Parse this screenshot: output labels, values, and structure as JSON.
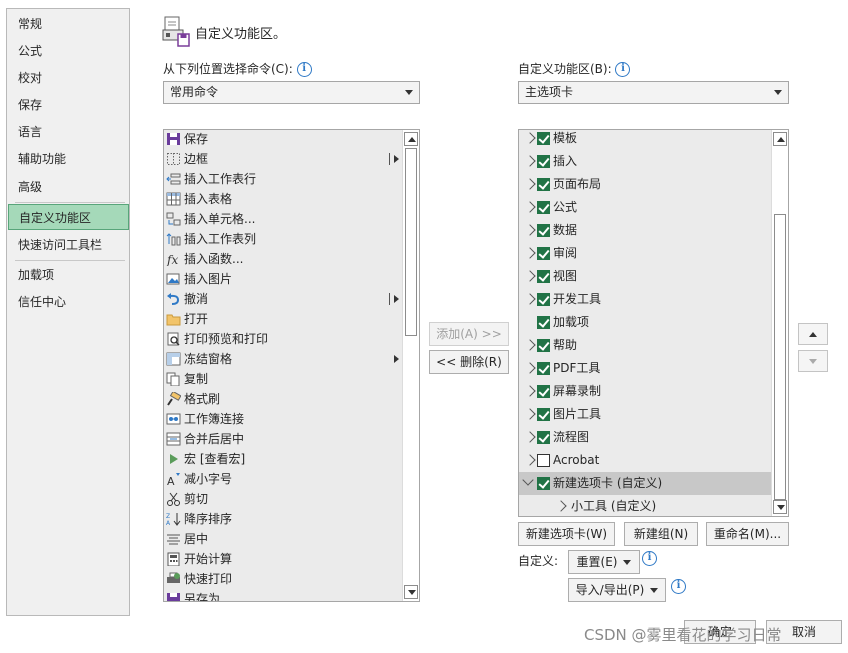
{
  "nav": {
    "items": [
      "常规",
      "公式",
      "校对",
      "保存",
      "语言",
      "辅助功能",
      "高级",
      "自定义功能区",
      "快速访问工具栏",
      "加载项",
      "信任中心"
    ],
    "selected": "自定义功能区"
  },
  "header": {
    "title": "自定义功能区。"
  },
  "left": {
    "choose_label": "从下列位置选择命令(C):",
    "choose_value": "常用命令",
    "commands": [
      {
        "label": "保存",
        "icon": "save-icon",
        "submenu": false
      },
      {
        "label": "边框",
        "icon": "border-icon",
        "submenu": true
      },
      {
        "label": "插入工作表行",
        "icon": "insert-row-icon",
        "submenu": false
      },
      {
        "label": "插入表格",
        "icon": "table-icon",
        "submenu": false
      },
      {
        "label": "插入单元格...",
        "icon": "insert-cell-icon",
        "submenu": false
      },
      {
        "label": "插入工作表列",
        "icon": "insert-column-icon",
        "submenu": false
      },
      {
        "label": "插入函数...",
        "icon": "function-icon",
        "submenu": false
      },
      {
        "label": "插入图片",
        "icon": "picture-icon",
        "submenu": false
      },
      {
        "label": "撤消",
        "icon": "undo-icon",
        "submenu": true
      },
      {
        "label": "打开",
        "icon": "folder-icon",
        "submenu": false
      },
      {
        "label": "打印预览和打印",
        "icon": "print-preview-icon",
        "submenu": false
      },
      {
        "label": "冻结窗格",
        "icon": "freeze-panes-icon",
        "submenu": "arrow"
      },
      {
        "label": "复制",
        "icon": "copy-icon",
        "submenu": false
      },
      {
        "label": "格式刷",
        "icon": "format-painter-icon",
        "submenu": false
      },
      {
        "label": "工作簿连接",
        "icon": "connections-icon",
        "submenu": false
      },
      {
        "label": "合并后居中",
        "icon": "merge-center-icon",
        "submenu": false
      },
      {
        "label": "宏 [查看宏]",
        "icon": "macro-play-icon",
        "submenu": false
      },
      {
        "label": "减小字号",
        "icon": "decrease-font-icon",
        "submenu": false
      },
      {
        "label": "剪切",
        "icon": "cut-icon",
        "submenu": false
      },
      {
        "label": "降序排序",
        "icon": "sort-desc-icon",
        "submenu": false
      },
      {
        "label": "居中",
        "icon": "align-center-icon",
        "submenu": false
      },
      {
        "label": "开始计算",
        "icon": "calculator-icon",
        "submenu": false
      },
      {
        "label": "快速打印",
        "icon": "quick-print-icon",
        "submenu": false
      },
      {
        "label": "另存为",
        "icon": "save-as-icon",
        "submenu": false
      }
    ]
  },
  "middle": {
    "add_label": "添加(A) >>",
    "remove_label": "<< 删除(R)"
  },
  "right": {
    "customize_label": "自定义功能区(B):",
    "customize_value": "主选项卡",
    "tabs": [
      {
        "label": "模板",
        "checked": true,
        "chevron": "right"
      },
      {
        "label": "插入",
        "checked": true,
        "chevron": "right"
      },
      {
        "label": "页面布局",
        "checked": true,
        "chevron": "right"
      },
      {
        "label": "公式",
        "checked": true,
        "chevron": "right"
      },
      {
        "label": "数据",
        "checked": true,
        "chevron": "right"
      },
      {
        "label": "审阅",
        "checked": true,
        "chevron": "right"
      },
      {
        "label": "视图",
        "checked": true,
        "chevron": "right"
      },
      {
        "label": "开发工具",
        "checked": true,
        "chevron": "right"
      },
      {
        "label": "加载项",
        "checked": true,
        "chevron": "none"
      },
      {
        "label": "帮助",
        "checked": true,
        "chevron": "right"
      },
      {
        "label": "PDF工具",
        "checked": true,
        "chevron": "right"
      },
      {
        "label": "屏幕录制",
        "checked": true,
        "chevron": "right"
      },
      {
        "label": "图片工具",
        "checked": true,
        "chevron": "right"
      },
      {
        "label": "流程图",
        "checked": true,
        "chevron": "right"
      },
      {
        "label": "Acrobat",
        "checked": false,
        "chevron": "right"
      },
      {
        "label": "新建选项卡 (自定义)",
        "checked": true,
        "chevron": "down",
        "selected": true
      }
    ],
    "subgroup": "小工具 (自定义)",
    "new_tab_label": "新建选项卡(W)",
    "new_group_label": "新建组(N)",
    "rename_label": "重命名(M)...",
    "customize_text": "自定义:",
    "reset_label": "重置(E)",
    "import_export_label": "导入/导出(P)"
  },
  "footer": {
    "ok_label": "确定",
    "cancel_label": "取消",
    "watermark": "CSDN @雾里看花的学习日常"
  },
  "colors": {
    "nav_selected": "#a5d9b9",
    "checkbox": "#217346",
    "info": "#2f79c6"
  }
}
